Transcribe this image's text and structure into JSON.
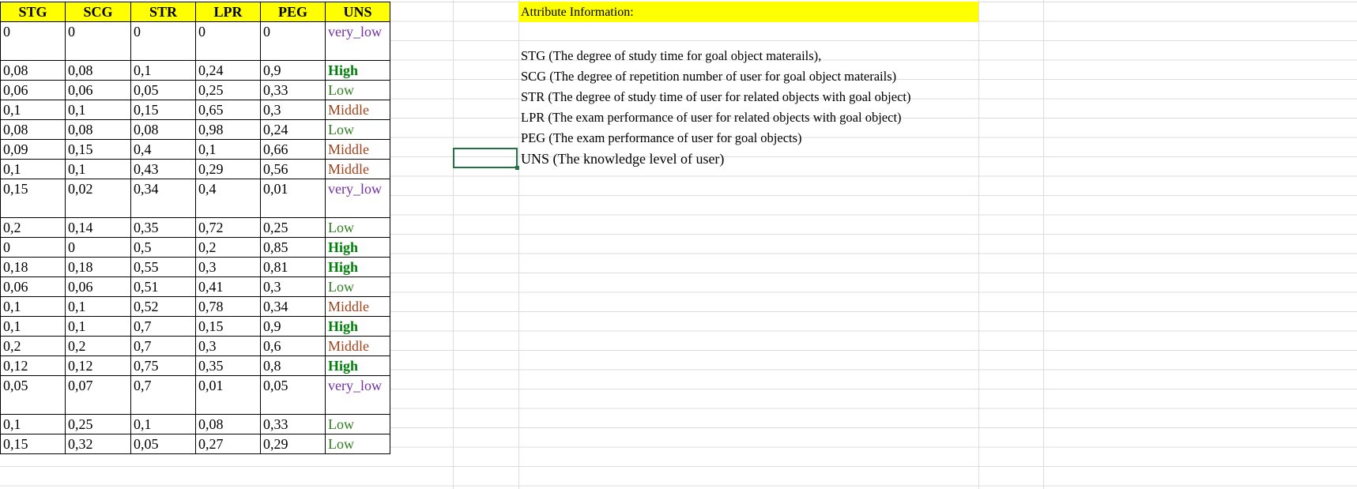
{
  "table": {
    "headers": [
      "STG",
      "SCG",
      "STR",
      "LPR",
      "PEG",
      "UNS"
    ],
    "rows": [
      [
        "0",
        "0",
        "0",
        "0",
        "0",
        "very_low"
      ],
      [
        "0,08",
        "0,08",
        "0,1",
        "0,24",
        "0,9",
        "High"
      ],
      [
        "0,06",
        "0,06",
        "0,05",
        "0,25",
        "0,33",
        "Low"
      ],
      [
        "0,1",
        "0,1",
        "0,15",
        "0,65",
        "0,3",
        "Middle"
      ],
      [
        "0,08",
        "0,08",
        "0,08",
        "0,98",
        "0,24",
        "Low"
      ],
      [
        "0,09",
        "0,15",
        "0,4",
        "0,1",
        "0,66",
        "Middle"
      ],
      [
        "0,1",
        "0,1",
        "0,43",
        "0,29",
        "0,56",
        "Middle"
      ],
      [
        "0,15",
        "0,02",
        "0,34",
        "0,4",
        "0,01",
        "very_low"
      ],
      [
        "0,2",
        "0,14",
        "0,35",
        "0,72",
        "0,25",
        "Low"
      ],
      [
        "0",
        "0",
        "0,5",
        "0,2",
        "0,85",
        "High"
      ],
      [
        "0,18",
        "0,18",
        "0,55",
        "0,3",
        "0,81",
        "High"
      ],
      [
        "0,06",
        "0,06",
        "0,51",
        "0,41",
        "0,3",
        "Low"
      ],
      [
        "0,1",
        "0,1",
        "0,52",
        "0,78",
        "0,34",
        "Middle"
      ],
      [
        "0,1",
        "0,1",
        "0,7",
        "0,15",
        "0,9",
        "High"
      ],
      [
        "0,2",
        "0,2",
        "0,7",
        "0,3",
        "0,6",
        "Middle"
      ],
      [
        "0,12",
        "0,12",
        "0,75",
        "0,35",
        "0,8",
        "High"
      ],
      [
        "0,05",
        "0,07",
        "0,7",
        "0,01",
        "0,05",
        "very_low"
      ],
      [
        "0,1",
        "0,25",
        "0,1",
        "0,08",
        "0,33",
        "Low"
      ],
      [
        "0,15",
        "0,32",
        "0,05",
        "0,27",
        "0,29",
        "Low"
      ]
    ]
  },
  "class_colors": {
    "very_low": "#7030a0",
    "High": "#00800a",
    "Low": "#2e7d1f",
    "Middle": "#a0421a"
  },
  "attributes": {
    "title": "Attribute Information:",
    "lines": [
      "STG (The degree of study time for goal object materails),",
      "SCG (The degree of repetition number of user for goal object materails)",
      "STR (The degree of study time of user for related objects with goal object)",
      "LPR (The exam performance of user for related objects with goal object)",
      "PEG (The exam performance of user for goal objects)",
      "UNS (The knowledge level of user)"
    ]
  }
}
